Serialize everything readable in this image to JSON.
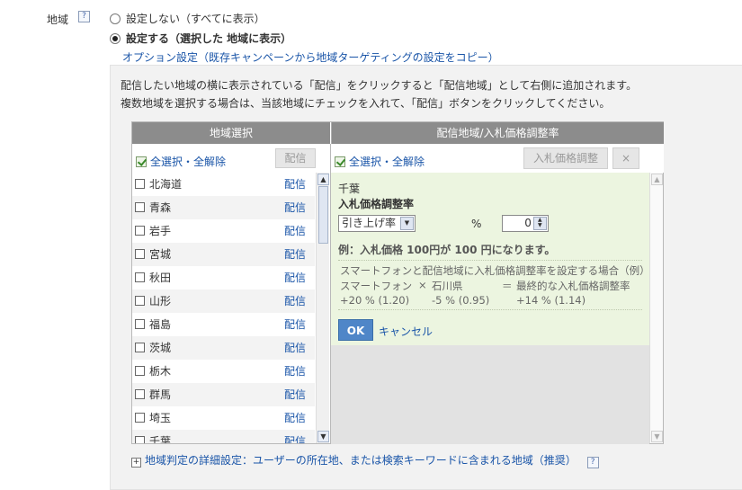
{
  "region": {
    "label": "地域",
    "help_icon": "?",
    "options": [
      {
        "label": "設定しない（すべてに表示）",
        "selected": false
      },
      {
        "label": "設定する（選択した 地域に表示）",
        "selected": true
      }
    ],
    "copy_link": "オプション設定（既存キャンペーンから地域ターゲティングの設定をコピー）"
  },
  "instructions": {
    "line1": "配信したい地域の横に表示されている「配信」をクリックすると「配信地域」として右側に追加されます。",
    "line2": "複数地域を選択する場合は、当該地域にチェックを入れて、「配信」ボタンをクリックしてください。"
  },
  "left_panel": {
    "header": "地域選択",
    "select_all": "全選択・全解除",
    "deliver_button": "配信",
    "row_action": "配信",
    "regions": [
      "北海道",
      "青森",
      "岩手",
      "宮城",
      "秋田",
      "山形",
      "福島",
      "茨城",
      "栃木",
      "群馬",
      "埼玉",
      "千葉"
    ]
  },
  "right_panel": {
    "header": "配信地域/入札価格調整率",
    "select_all": "全選択・全解除",
    "bid_adjust_button": "入札価格調整",
    "remove_button": "×",
    "editor": {
      "region_name": "千葉",
      "title": "入札価格調整率",
      "direction_value": "引き上げ率",
      "percent_value": "0",
      "percent_unit": "%",
      "example": "例：入札価格 100円が 100 円になります。",
      "note_title": "スマートフォンと配信地域に入札価格調整率を設定する場合（例）",
      "note_col1_head": "スマートフォン",
      "note_op1": "×",
      "note_col2_head": "石川県",
      "note_op2": "＝",
      "note_col3_head": "最終的な入札価格調整率",
      "note_col1_val": "+20 % (1.20)",
      "note_col2_val": "-5 % (0.95)",
      "note_col3_val": "+14 % (1.14)",
      "ok_button": "OK",
      "cancel_link": "キャンセル"
    }
  },
  "advanced": {
    "expand_icon": "+",
    "label": "地域判定の詳細設定：ユーザーの所在地、または検索キーワードに含まれる地域（推奨）",
    "help_icon": "?"
  }
}
